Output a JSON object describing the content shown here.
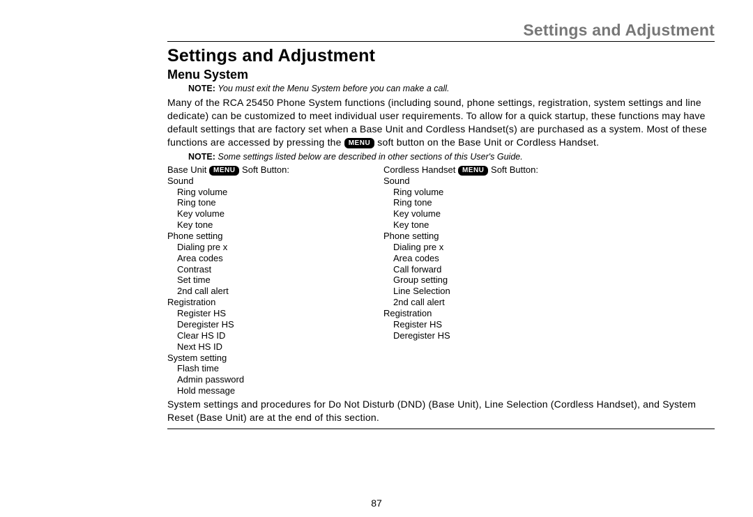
{
  "runningHead": "Settings and Adjustment",
  "title": "Settings and Adjustment",
  "subtitle": "Menu System",
  "note1": {
    "label": "NOTE:",
    "text": "You must exit the Menu System before you can make a call."
  },
  "intro": {
    "p1a": "Many of the RCA 25450 Phone System functions (including sound, phone settings, registration, system settings and line dedicate) can be customized to meet individual user requirements. To allow for a quick startup, these functions may have default settings that are factory set when a Base Unit and Cordless Handset(s) are purchased as a system. Most of these functions are accessed by pressing the ",
    "badge": "MENU",
    "p1b": " soft button on the Base Unit or Cordless Handset."
  },
  "note2": {
    "label": "NOTE:",
    "text": "Some settings listed below are described in other sections of this User's Guide."
  },
  "columns": {
    "left": {
      "headPrefix": "Base Unit ",
      "badge": "MENU",
      "headSuffix": " Soft Button:",
      "groups": [
        {
          "title": "Sound",
          "items": [
            "Ring volume",
            "Ring tone",
            "Key volume",
            "Key tone"
          ]
        },
        {
          "title": "Phone setting",
          "items": [
            "Dialing pre x",
            "Area codes",
            "Contrast",
            "Set time",
            "2nd call alert"
          ]
        },
        {
          "title": "Registration",
          "items": [
            "Register HS",
            "Deregister HS",
            "Clear HS ID",
            "Next HS ID"
          ]
        },
        {
          "title": "System setting",
          "items": [
            "Flash time",
            "Admin password",
            "Hold message"
          ]
        }
      ]
    },
    "right": {
      "headPrefix": "Cordless Handset ",
      "badge": "MENU",
      "headSuffix": " Soft Button:",
      "groups": [
        {
          "title": "Sound",
          "items": [
            "Ring volume",
            "Ring tone",
            "Key volume",
            "Key tone"
          ]
        },
        {
          "title": "Phone setting",
          "items": [
            "Dialing pre x",
            "Area codes",
            "Call forward",
            "Group setting",
            "Line Selection",
            "2nd call alert"
          ]
        },
        {
          "title": "Registration",
          "items": [
            "Register HS",
            "Deregister HS"
          ]
        }
      ]
    }
  },
  "closing": "System settings and procedures for Do Not Disturb (DND) (Base Unit), Line Selection (Cordless Handset), and System Reset (Base Unit) are at the end of this section.",
  "pageNumber": "87"
}
